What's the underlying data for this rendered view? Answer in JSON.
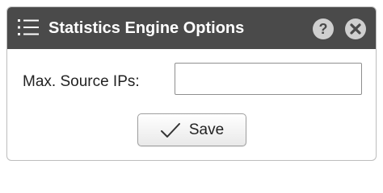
{
  "dialog": {
    "title": "Statistics Engine Options",
    "icons": {
      "menu": "list-icon",
      "help": "help-icon",
      "close": "close-icon"
    },
    "help_glyph": "?"
  },
  "form": {
    "max_source_ips": {
      "label": "Max. Source IPs:",
      "value": ""
    }
  },
  "actions": {
    "save_label": "Save",
    "save_icon": "checkmark-icon"
  },
  "colors": {
    "titlebar": "#4a4a4a",
    "title_text": "#ffffff",
    "icon_circle": "#cfcfcf"
  }
}
